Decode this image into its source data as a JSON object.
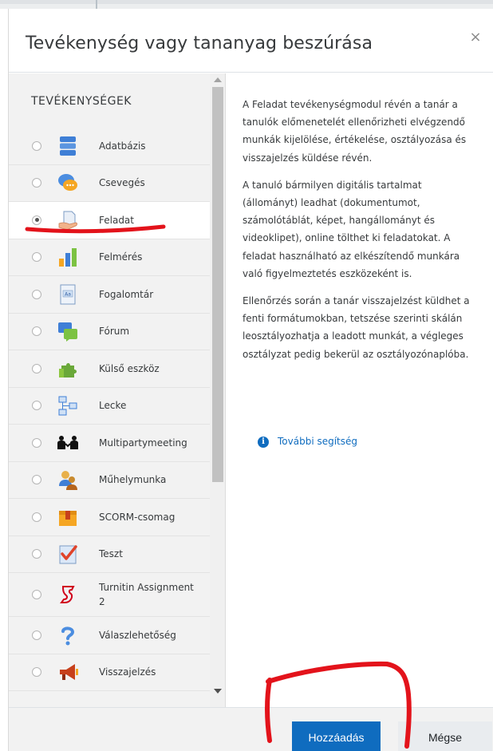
{
  "dialog": {
    "title": "Tevékenység vagy tananyag beszúrása",
    "close_symbol": "×"
  },
  "sidebar": {
    "section_title": "TEVÉKENYSÉGEK",
    "items": [
      {
        "label": "Adatbázis",
        "icon": "database-icon",
        "selected": false
      },
      {
        "label": "Csevegés",
        "icon": "chat-icon",
        "selected": false
      },
      {
        "label": "Feladat",
        "icon": "assignment-icon",
        "selected": true
      },
      {
        "label": "Felmérés",
        "icon": "survey-chart-icon",
        "selected": false
      },
      {
        "label": "Fogalomtár",
        "icon": "glossary-icon",
        "selected": false
      },
      {
        "label": "Fórum",
        "icon": "forum-icon",
        "selected": false
      },
      {
        "label": "Külső eszköz",
        "icon": "puzzle-icon",
        "selected": false
      },
      {
        "label": "Lecke",
        "icon": "lesson-icon",
        "selected": false
      },
      {
        "label": "Multipartymeeting",
        "icon": "meeting-icon",
        "selected": false
      },
      {
        "label": "Műhelymunka",
        "icon": "workshop-icon",
        "selected": false
      },
      {
        "label": "SCORM-csomag",
        "icon": "package-icon",
        "selected": false
      },
      {
        "label": "Teszt",
        "icon": "quiz-icon",
        "selected": false
      },
      {
        "label": "Turnitin Assignment 2",
        "icon": "turnitin-icon",
        "selected": false
      },
      {
        "label": "Válaszlehetőség",
        "icon": "question-icon",
        "selected": false
      },
      {
        "label": "Visszajelzés",
        "icon": "megaphone-icon",
        "selected": false
      }
    ]
  },
  "description": {
    "paragraphs": [
      "A Feladat tevékenységmodul révén a tanár a tanulók előmenetelét ellenőrizheti elvégzendő munkák kijelölése, értékelése, osztályozása és visszajelzés küldése révén.",
      "A tanuló bármilyen digitális tartalmat (állományt) leadhat (dokumentumot, számolótáblát, képet, hangállományt és videoklipet), online tölthet ki feladatokat. A feladat használható az elkészítendő munkára való figyelmeztetés eszközeként is.",
      "Ellenőrzés során a tanár visszajelzést küldhet a fenti formátumokban, tetszése szerinti skálán leosztályozhatja a leadott munkát, a végleges osztályzat pedig bekerül az osztályozónaplóba."
    ],
    "help_link": "További segítség",
    "help_icon_glyph": "i"
  },
  "footer": {
    "add_label": "Hozzáadás",
    "cancel_label": "Mégse"
  },
  "colors": {
    "primary": "#0f6cbf",
    "annotation": "#e3131b"
  }
}
